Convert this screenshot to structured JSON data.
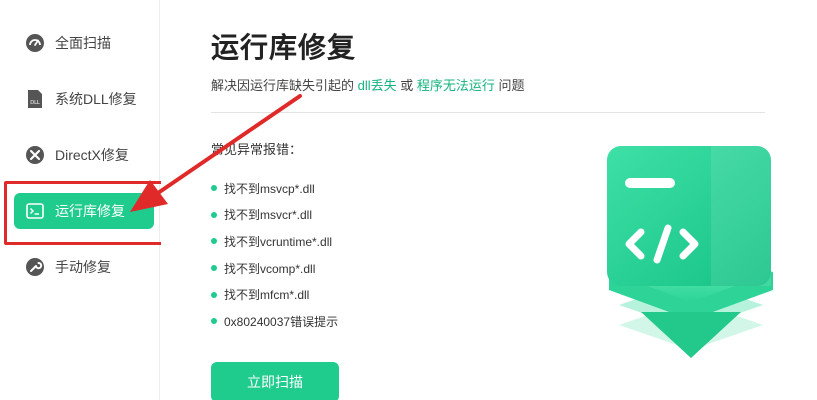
{
  "sidebar": {
    "items": [
      {
        "label": "全面扫描",
        "icon": "gauge-icon",
        "active": false
      },
      {
        "label": "系统DLL修复",
        "icon": "dll-file-icon",
        "active": false
      },
      {
        "label": "DirectX修复",
        "icon": "directx-icon",
        "active": false
      },
      {
        "label": "运行库修复",
        "icon": "terminal-icon",
        "active": true
      },
      {
        "label": "手动修复",
        "icon": "wrench-icon",
        "active": false
      }
    ]
  },
  "main": {
    "title": "运行库修复",
    "subtitle": {
      "prefix": "解决因运行库缺失引起的 ",
      "highlight1": "dll丢失",
      "middle": " 或 ",
      "highlight2": "程序无法运行",
      "suffix": " 问题"
    },
    "errors_title": "常见异常报错：",
    "errors": [
      "找不到msvcp*.dll",
      "找不到msvcr*.dll",
      "找不到vcruntime*.dll",
      "找不到vcomp*.dll",
      "找不到mfcm*.dll",
      "0x80240037错误提示"
    ],
    "scan_button": "立即扫描"
  },
  "colors": {
    "accent": "#1fcc8e",
    "accent_text": "#16b37c",
    "annotation_red": "#e02a2a"
  }
}
